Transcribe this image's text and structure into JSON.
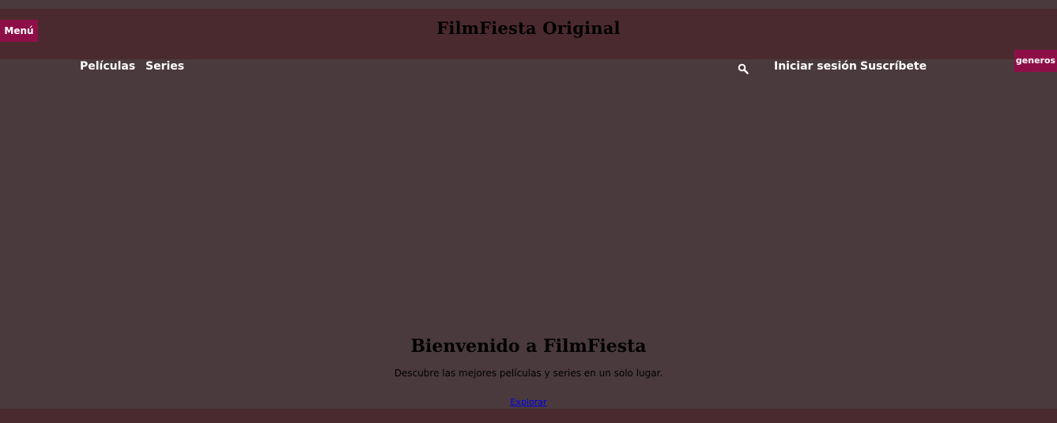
{
  "header": {
    "site_title": "FilmFiesta Original",
    "menu_label": "Menú",
    "generos_label": "generos"
  },
  "nav": {
    "left": [
      "Películas",
      "Series"
    ],
    "search_icon": "search-icon",
    "login_label": "Iniciar sesión",
    "subscribe_label": "Suscríbete"
  },
  "hero": {
    "title": "Bienvenido a FilmFiesta",
    "subtitle": "Descubre las mejores películas y series en un solo lugar.",
    "cta_label": "Explorar"
  },
  "colors": {
    "background": "#4a3a3d",
    "header_bar": "#4b2a2f",
    "accent": "#8e0f47"
  }
}
